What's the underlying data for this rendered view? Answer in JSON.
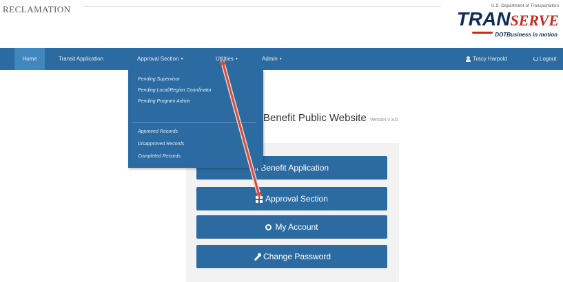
{
  "header": {
    "agency_name": "RECLAMATION",
    "brand": {
      "department": "U.S. Department of Transportation",
      "logo_primary": "TRAN",
      "logo_secondary": "SERVE",
      "tagline": "DOTBusiness in motion"
    }
  },
  "nav": {
    "items": [
      {
        "label": "Home",
        "active": true
      },
      {
        "label": "Transit Application"
      },
      {
        "label": "Approval Section",
        "has_caret": true
      },
      {
        "label": "Utilities",
        "has_caret": true
      },
      {
        "label": "Admin",
        "has_caret": true
      }
    ],
    "user_name": "Tracy Harpold",
    "logout_label": "Logout",
    "caret_glyph": "▾"
  },
  "approval_dropdown": {
    "group1": [
      "Pending Supervisor",
      "Pending Local/Region Coordinator",
      "Pending Program Admin"
    ],
    "group2": [
      "Approved Records",
      "Disapproved Records",
      "Completed Records"
    ]
  },
  "main": {
    "title": "Benefit Public Website",
    "version": "Version v 3.0",
    "buttons": {
      "application": "ill Benefit Application",
      "approval": "Approval Section",
      "account": "My Account",
      "password": "Change Password"
    }
  },
  "colors": {
    "nav_blue": "#2b6ba2",
    "annotation_arrow": "#d64a3a",
    "brand_navy": "#0f2c57",
    "brand_red": "#c62a25"
  },
  "icons": {
    "user": "user-icon",
    "logout": "power-icon",
    "approval": "grid-icon",
    "account": "gear-icon",
    "password": "wrench-icon"
  }
}
